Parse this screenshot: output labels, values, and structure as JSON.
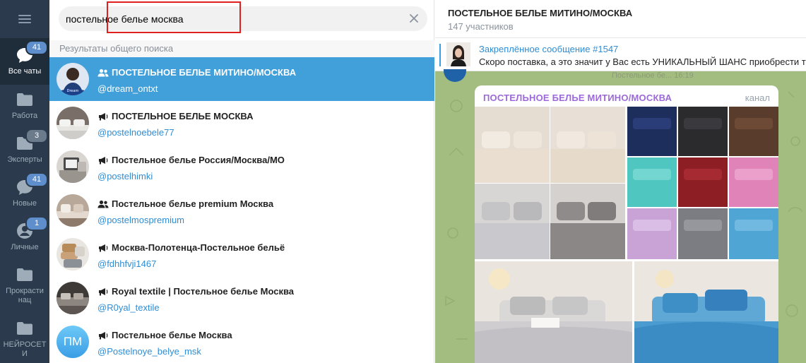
{
  "rail": {
    "folders": [
      {
        "label": "Все чаты",
        "badge": "41",
        "active": true
      },
      {
        "label": "Работа",
        "badge": ""
      },
      {
        "label": "Эксперты",
        "badge": "3"
      },
      {
        "label": "Новые",
        "badge": "41"
      },
      {
        "label": "Личные",
        "badge": "1"
      },
      {
        "label": "Прокрасти нац",
        "badge": ""
      },
      {
        "label": "НЕЙРОСЕТ И",
        "badge": ""
      }
    ]
  },
  "search": {
    "query": "постельное белье москва",
    "section_header": "Результаты общего поиска",
    "results": [
      {
        "title": "ПОСТЕЛЬНОЕ БЕЛЬЕ МИТИНО/МОСКВА",
        "username": "@dream_ontxt",
        "kind": "group"
      },
      {
        "title": "ПОСТЕЛЬНОЕ БЕЛЬЕ МОСКВА",
        "username": "@postelnoebele77",
        "kind": "channel"
      },
      {
        "title": "Постельное белье Россия/Москва/МО",
        "username": "@postelhimki",
        "kind": "channel"
      },
      {
        "title": "Постельное белье premium Москва",
        "username": "@postelmospremium",
        "kind": "group"
      },
      {
        "title": "Москва-Полотенца-Постельное бельё",
        "username": "@fdhhfvji1467",
        "kind": "channel"
      },
      {
        "title": "Royal textile | Постельное белье Москва",
        "username": "@R0yal_textile",
        "kind": "channel"
      },
      {
        "title": "Постельное белье Москва",
        "username": "@Postelnoye_belye_msk",
        "kind": "channel",
        "initials": "ПМ"
      }
    ]
  },
  "chat": {
    "title": "ПОСТЕЛЬНОЕ БЕЛЬЕ МИТИНО/МОСКВА",
    "subtitle": "147 участников",
    "pinned_title": "Закреплённое сообщение #1547",
    "pinned_text": "Скоро поставка, а это значит у Вас есть УНИКАЛЬНЫЙ ШАНС приобрести т",
    "behind_text": "Постельное бе... 16:19",
    "post_title": "ПОСТЕЛЬНОЕ БЕЛЬЕ МИТИНО/МОСКВА",
    "post_kind": "канал"
  },
  "colors": {
    "rail_bg": "#2b3b4d",
    "selected_row": "#419fd9",
    "link": "#2f8dd4",
    "chat_wallpaper": "#a3bc80",
    "post_title": "#9c6ad8",
    "highlight_border": "#e0201f"
  }
}
